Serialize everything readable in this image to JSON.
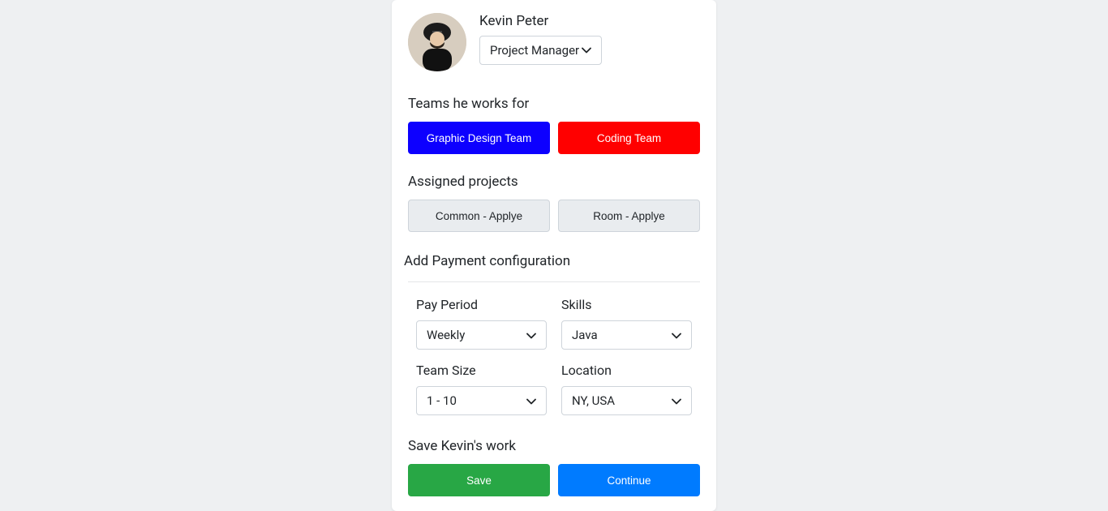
{
  "profile": {
    "name": "Kevin Peter",
    "role": "Project Manager"
  },
  "teams": {
    "title": "Teams he works for",
    "items": [
      "Graphic Design Team",
      "Coding Team"
    ],
    "colors": [
      "#0d00ff",
      "#ff0000"
    ]
  },
  "assigned": {
    "title": "Assigned projects",
    "items": [
      "Common - Applye",
      "Room - Applye"
    ]
  },
  "paymentConfig": {
    "title": "Add Payment configuration",
    "fields": {
      "payPeriod": {
        "label": "Pay Period",
        "value": "Weekly"
      },
      "skills": {
        "label": "Skills",
        "value": "Java"
      },
      "teamSize": {
        "label": "Team Size",
        "value": "1 - 10"
      },
      "location": {
        "label": "Location",
        "value": "NY, USA"
      }
    }
  },
  "save": {
    "title": "Save Kevin's work",
    "saveLabel": "Save",
    "continueLabel": "Continue"
  }
}
